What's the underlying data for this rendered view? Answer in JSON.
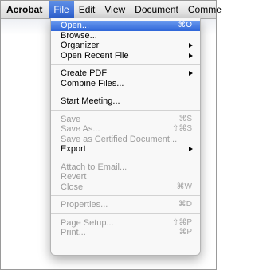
{
  "menubar": {
    "app": "Acrobat",
    "items": [
      "File",
      "Edit",
      "View",
      "Document",
      "Comme"
    ]
  },
  "file_menu": {
    "groups": [
      [
        {
          "label": "Open...",
          "shortcut": "⌘O",
          "highlighted": true
        },
        {
          "label": "Browse...",
          "shortcut": ""
        },
        {
          "label": "Organizer",
          "submenu": true
        },
        {
          "label": "Open Recent File",
          "submenu": true
        }
      ],
      [
        {
          "label": "Create PDF",
          "submenu": true
        },
        {
          "label": "Combine Files..."
        }
      ],
      [
        {
          "label": "Start Meeting..."
        }
      ],
      [
        {
          "label": "Save",
          "shortcut": "⌘S",
          "disabled": true
        },
        {
          "label": "Save As...",
          "shortcut": "⇧⌘S",
          "disabled": true
        },
        {
          "label": "Save as Certified Document...",
          "disabled": true
        },
        {
          "label": "Export",
          "submenu": true
        }
      ],
      [
        {
          "label": "Attach to Email...",
          "disabled": true
        },
        {
          "label": "Revert",
          "disabled": true
        },
        {
          "label": "Close",
          "shortcut": "⌘W",
          "disabled": true
        }
      ],
      [
        {
          "label": "Properties...",
          "shortcut": "⌘D",
          "disabled": true
        }
      ],
      [
        {
          "label": "Page Setup...",
          "shortcut": "⇧⌘P",
          "disabled": true
        },
        {
          "label": "Print...",
          "shortcut": "⌘P",
          "disabled": true
        }
      ]
    ]
  }
}
